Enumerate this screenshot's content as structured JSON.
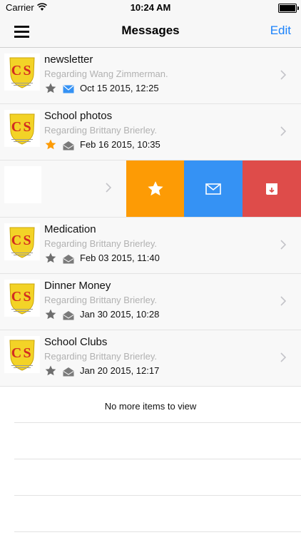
{
  "status_bar": {
    "carrier": "Carrier",
    "time": "10:24 AM"
  },
  "nav": {
    "title": "Messages",
    "edit_label": "Edit"
  },
  "messages": [
    {
      "subject": "newsletter",
      "regarding": "Regarding Wang Zimmerman.",
      "date": "Oct 15 2015, 12:25",
      "starred": false,
      "unread": true
    },
    {
      "subject": "School photos",
      "regarding": "Regarding Brittany Brierley.",
      "date": "Feb 16 2015, 10:35",
      "starred": true,
      "unread": false
    },
    {
      "subject": "Medication",
      "regarding": "Regarding Brittany Brierley.",
      "date": "Feb 03 2015, 11:40",
      "starred": false,
      "unread": false
    },
    {
      "subject": "Dinner Money",
      "regarding": "Regarding Brittany Brierley.",
      "date": "Jan 30 2015, 10:28",
      "starred": false,
      "unread": false
    },
    {
      "subject": "School Clubs",
      "regarding": "Regarding Brittany Brierley.",
      "date": "Jan 20 2015, 12:17",
      "starred": false,
      "unread": false
    }
  ],
  "swipe_actions": {
    "icons": [
      "star-icon",
      "envelope-icon",
      "archive-icon"
    ]
  },
  "footer": {
    "no_more": "No more items to view"
  },
  "colors": {
    "accent": "#1a82fb",
    "star_active": "#fd9b05",
    "action_favorite": "#fd9b05",
    "action_mail": "#3592f4",
    "action_archive": "#de4c4a",
    "unread_envelope": "#3592f4"
  }
}
